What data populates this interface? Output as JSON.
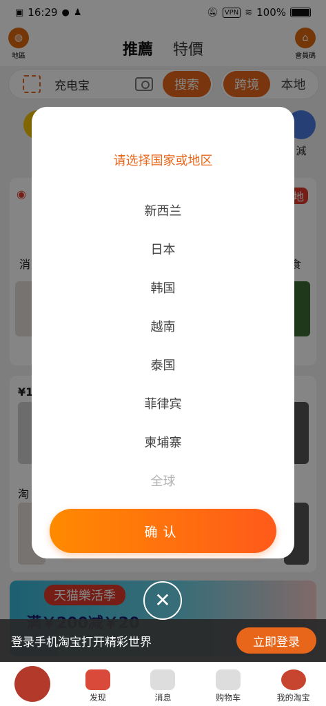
{
  "status": {
    "time": "16:29",
    "vpn": "VPN",
    "battery": "100%"
  },
  "header": {
    "left_label": "地區",
    "right_label": "會員碼",
    "tabs": [
      {
        "label": "推薦"
      },
      {
        "label": "特價"
      }
    ]
  },
  "search": {
    "text": "充电宝",
    "button": "搜索"
  },
  "toggle": {
    "on": "跨境",
    "off": "本地"
  },
  "background": {
    "cat_left": "淘",
    "cat_right": "減",
    "badge_right": "地",
    "label_left": "消",
    "label_right": "食",
    "price": "¥1",
    "taobao": "淘"
  },
  "promo": {
    "tag": "天猫樂活季",
    "amount": "满￥200减￥20"
  },
  "login": {
    "text": "登录手机淘宝打开精彩世界",
    "button": "立即登录"
  },
  "nav": [
    {
      "label": ""
    },
    {
      "label": "发现"
    },
    {
      "label": "消息"
    },
    {
      "label": "购物车"
    },
    {
      "label": "我的淘宝"
    }
  ],
  "modal": {
    "title": "请选择国家或地区",
    "options": [
      "新西兰",
      "日本",
      "韩国",
      "越南",
      "泰国",
      "菲律宾",
      "柬埔寨",
      "全球"
    ],
    "confirm": "确认"
  },
  "colors": {
    "accent": "#e8661a",
    "confirm_gradient_start": "#ff8a00",
    "confirm_gradient_end": "#ff5a1a"
  }
}
